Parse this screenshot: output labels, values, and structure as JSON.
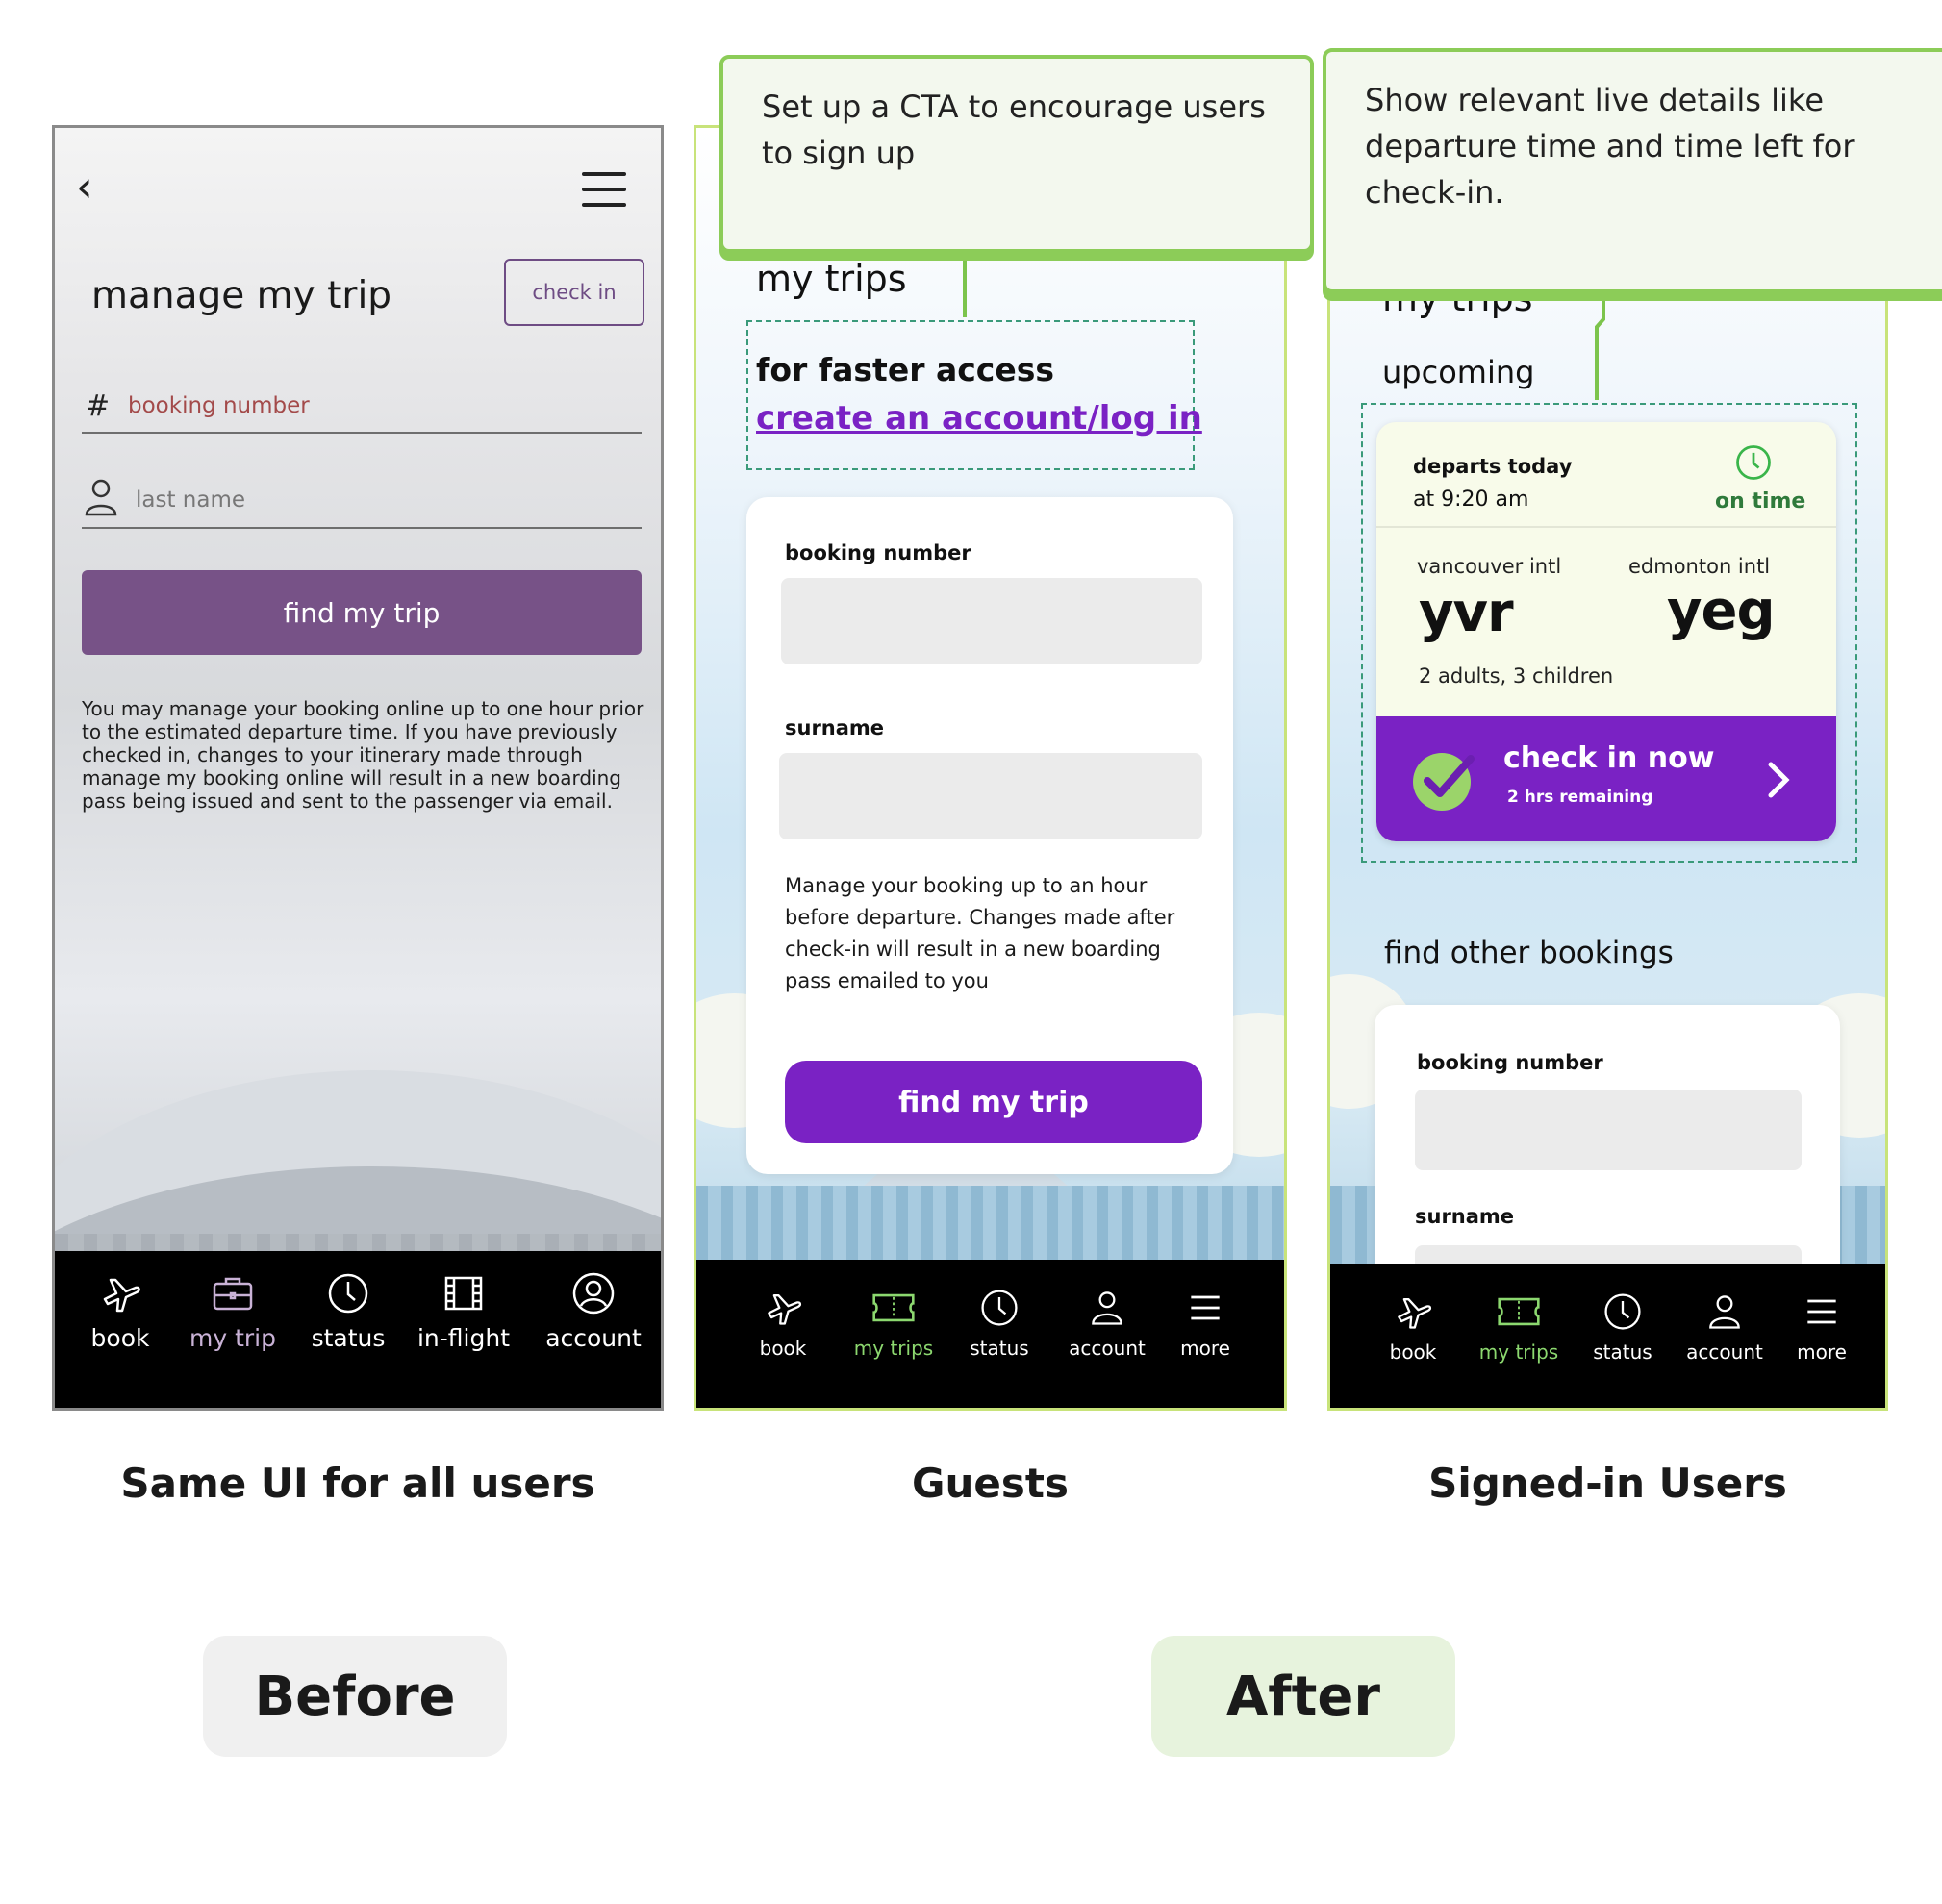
{
  "before": {
    "title": "manage my trip",
    "check_in_label": "check in",
    "booking_placeholder": "booking number",
    "lastname_placeholder": "last name",
    "button": "find my trip",
    "body_text": "You may manage your booking online up to one hour prior to the estimated departure time. If you have previously checked in, changes to your itinerary made through manage my booking online will result in a new boarding pass being issued and sent to the passenger via email.",
    "nav": [
      {
        "label": "book",
        "icon": "plane-icon"
      },
      {
        "label": "my trip",
        "icon": "briefcase-icon"
      },
      {
        "label": "status",
        "icon": "clock-icon"
      },
      {
        "label": "in-flight",
        "icon": "film-icon"
      },
      {
        "label": "account",
        "icon": "user-circle-icon"
      }
    ],
    "caption": "Same UI for all users",
    "pill": "Before"
  },
  "guests": {
    "callout": "Set up a CTA to encourage users to sign up",
    "heading": "my trips",
    "cta_line1": "for faster access",
    "cta_link": "create an account/log in",
    "booking_label": "booking number",
    "surname_label": "surname",
    "body_text": "Manage your booking up to an hour before departure. Changes made after check-in will result in a new boarding pass emailed to you",
    "button": "find my trip",
    "nav": [
      {
        "label": "book",
        "icon": "plane-icon"
      },
      {
        "label": "my trips",
        "icon": "ticket-icon"
      },
      {
        "label": "status",
        "icon": "clock-icon"
      },
      {
        "label": "account",
        "icon": "user-icon"
      },
      {
        "label": "more",
        "icon": "menu-icon"
      }
    ],
    "caption": "Guests"
  },
  "signed_in": {
    "callout": "Show relevant live details like departure time and time left for check-in.",
    "heading": "my trips",
    "upcoming": "upcoming",
    "trip": {
      "departs": "departs today",
      "time": "at 9:20 am",
      "status": "on time",
      "from_name": "vancouver intl",
      "from_code": "yvr",
      "to_name": "edmonton intl",
      "to_code": "yeg",
      "passengers": "2 adults, 3 children",
      "checkin": "check in now",
      "remaining": "2 hrs remaining"
    },
    "find_other": "find other bookings",
    "booking_label": "booking number",
    "surname_label": "surname",
    "nav": [
      {
        "label": "book",
        "icon": "plane-icon"
      },
      {
        "label": "my trips",
        "icon": "ticket-icon"
      },
      {
        "label": "status",
        "icon": "clock-icon"
      },
      {
        "label": "account",
        "icon": "user-icon"
      },
      {
        "label": "more",
        "icon": "menu-icon"
      }
    ],
    "caption": "Signed-in Users",
    "pill": "After"
  },
  "colors": {
    "before_purple": "#775287",
    "after_purple": "#7a22c4",
    "accent_green": "#8ccc58",
    "nav_active_green": "#8cd86f"
  }
}
